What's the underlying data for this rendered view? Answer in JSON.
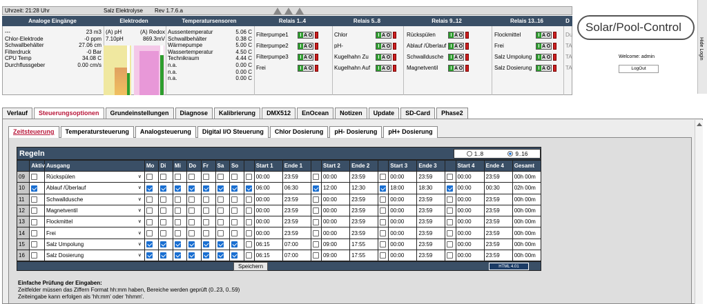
{
  "topbar": {
    "time": "Uhrzeit: 21:28 Uhr",
    "name": "Salz Elektrolyse",
    "rev": "Rev 1.7.6.a"
  },
  "sections": [
    "Analoge Eingänge",
    "Elektroden",
    "Temperatursensoren",
    "Relais 1..4",
    "Relais 5..8",
    "Relais 9..12",
    "Relais 13..16",
    "D"
  ],
  "analog": [
    {
      "l": "---",
      "v": "23 m3"
    },
    {
      "l": "Chlor-Elektrode",
      "v": "-0 ppm"
    },
    {
      "l": "Schwallbehälter",
      "v": "27.06 cm"
    },
    {
      "l": "Filterdruck",
      "v": "-0 Bar"
    },
    {
      "l": "CPU Temp",
      "v": "34.08 C"
    },
    {
      "l": "Durchflussgeber",
      "v": "0.00 cm/s"
    }
  ],
  "electrodes": {
    "ph_label": "(A) pH",
    "ph_value": "7.10pH",
    "redox_label": "(A) Redox",
    "redox_value": "869.3mV",
    "ph_level": 0.45,
    "redox_level": 0.8
  },
  "temps": [
    {
      "l": "Aussentemperatur",
      "v": "5.06 C"
    },
    {
      "l": "Schwallbehälter",
      "v": "0.38 C"
    },
    {
      "l": "Wärmepumpe",
      "v": "5.00 C"
    },
    {
      "l": "Wassertemperatur",
      "v": "4.50 C"
    },
    {
      "l": "Technikraum",
      "v": "4.44 C"
    },
    {
      "l": "n.a.",
      "v": "0.00 C"
    },
    {
      "l": "n.a.",
      "v": "0.00 C"
    },
    {
      "l": "n.a.",
      "v": "0.00 C"
    }
  ],
  "relais1": [
    "Filterpumpe1",
    "Filterpumpe2",
    "Filterpumpe3",
    "Frei"
  ],
  "relais2": [
    "Chlor",
    "pH-",
    "Kugelhahn Zu",
    "Kugelhahn Auf"
  ],
  "relais3": [
    "Rückspülen",
    "Ablauf /Überlauf",
    "Schwalldusche",
    "Magnetventil"
  ],
  "relais4": [
    "Flockmittel",
    "Frei",
    "Salz Umpolung",
    "Salz Dosierung"
  ],
  "relais5": [
    "Du",
    "TA",
    "TA",
    "TA"
  ],
  "iao": {
    "i": "I",
    "a": "A",
    "o": "O"
  },
  "logo": "Solar/Pool-Control",
  "welcome": "Welcome:  admin",
  "logout": "LogOut",
  "hide_login": "Hide Login",
  "main_tabs": [
    "Verlauf",
    "Steuerungsoptionen",
    "Grundeinstellungen",
    "Diagnose",
    "Kalibrierung",
    "DMX512",
    "EnOcean",
    "Notizen",
    "Update",
    "SD-Card",
    "Phase2"
  ],
  "sub_tabs": [
    "Zeitsteuerung",
    "Temperatursteuerung",
    "Analogsteuerung",
    "Digital I/O Steuerung",
    "Chlor Dosierung",
    "pH- Dosierung",
    "pH+ Dosierung"
  ],
  "regeln": {
    "title": "Regeln",
    "range1": "1..8",
    "range2": "9..16",
    "headers": [
      "",
      "Aktiv",
      "Ausgang",
      "Mo",
      "Di",
      "Mi",
      "Do",
      "Fr",
      "Sa",
      "So",
      "",
      "Start 1",
      "Ende 1",
      "",
      "Start 2",
      "Ende 2",
      "",
      "Start 3",
      "Ende 3",
      "",
      "Start 4",
      "Ende 4",
      "Gesamt"
    ],
    "rows": [
      {
        "n": "09",
        "a": false,
        "o": "Rückspülen",
        "d": [
          false,
          false,
          false,
          false,
          false,
          false,
          false
        ],
        "c1": false,
        "s1": "00:00",
        "e1": "23:59",
        "c2": false,
        "s2": "00:00",
        "e2": "23:59",
        "c3": false,
        "s3": "00:00",
        "e3": "23:59",
        "c4": false,
        "s4": "00:00",
        "e4": "23:59",
        "g": "00h 00m"
      },
      {
        "n": "10",
        "a": true,
        "o": "Ablauf /Überlauf",
        "d": [
          true,
          true,
          true,
          true,
          true,
          true,
          true
        ],
        "c1": true,
        "s1": "06:00",
        "e1": "06:30",
        "c2": true,
        "s2": "12:00",
        "e2": "12:30",
        "c3": true,
        "s3": "18:00",
        "e3": "18:30",
        "c4": true,
        "s4": "00:00",
        "e4": "00:30",
        "g": "02h 00m"
      },
      {
        "n": "11",
        "a": false,
        "o": "Schwalldusche",
        "d": [
          false,
          false,
          false,
          false,
          false,
          false,
          false
        ],
        "c1": false,
        "s1": "00:00",
        "e1": "23:59",
        "c2": false,
        "s2": "00:00",
        "e2": "23:59",
        "c3": false,
        "s3": "00:00",
        "e3": "23:59",
        "c4": false,
        "s4": "00:00",
        "e4": "23:59",
        "g": "00h 00m"
      },
      {
        "n": "12",
        "a": false,
        "o": "Magnetventil",
        "d": [
          false,
          false,
          false,
          false,
          false,
          false,
          false
        ],
        "c1": false,
        "s1": "00:00",
        "e1": "23:59",
        "c2": false,
        "s2": "00:00",
        "e2": "23:59",
        "c3": false,
        "s3": "00:00",
        "e3": "23:59",
        "c4": false,
        "s4": "00:00",
        "e4": "23:59",
        "g": "00h 00m"
      },
      {
        "n": "13",
        "a": false,
        "o": "Flockmittel",
        "d": [
          false,
          false,
          false,
          false,
          false,
          false,
          false
        ],
        "c1": false,
        "s1": "00:00",
        "e1": "23:59",
        "c2": false,
        "s2": "00:00",
        "e2": "23:59",
        "c3": false,
        "s3": "00:00",
        "e3": "23:59",
        "c4": false,
        "s4": "00:00",
        "e4": "23:59",
        "g": "00h 00m"
      },
      {
        "n": "14",
        "a": false,
        "o": "Frei",
        "d": [
          false,
          false,
          false,
          false,
          false,
          false,
          false
        ],
        "c1": false,
        "s1": "00:00",
        "e1": "23:59",
        "c2": false,
        "s2": "00:00",
        "e2": "23:59",
        "c3": false,
        "s3": "00:00",
        "e3": "23:59",
        "c4": false,
        "s4": "00:00",
        "e4": "23:59",
        "g": "00h 00m"
      },
      {
        "n": "15",
        "a": false,
        "o": "Salz Umpolung",
        "d": [
          true,
          true,
          true,
          true,
          true,
          true,
          true
        ],
        "c1": false,
        "s1": "06:15",
        "e1": "07:00",
        "c2": false,
        "s2": "09:00",
        "e2": "17:55",
        "c3": false,
        "s3": "00:00",
        "e3": "23:59",
        "c4": false,
        "s4": "00:00",
        "e4": "23:59",
        "g": "00h 00m"
      },
      {
        "n": "16",
        "a": false,
        "o": "Salz Dosierung",
        "d": [
          true,
          true,
          true,
          true,
          true,
          true,
          true
        ],
        "c1": false,
        "s1": "06:15",
        "e1": "07:00",
        "c2": false,
        "s2": "09:00",
        "e2": "17:55",
        "c3": false,
        "s3": "00:00",
        "e3": "23:59",
        "c4": false,
        "s4": "00:00",
        "e4": "23:59",
        "g": "00h 00m"
      }
    ],
    "save": "Speichern",
    "html_badge": "HTML 4.01"
  },
  "notes": {
    "title": "Einfache Prüfung der Eingaben:",
    "line1": "Zeitfelder müssen das Ziffern Format hh:mm haben, Bereiche werden geprüft (0..23, 0..59)",
    "line2": "Zeiteingabe kann erfolgen als 'hh:mm' oder 'hhmm'."
  }
}
